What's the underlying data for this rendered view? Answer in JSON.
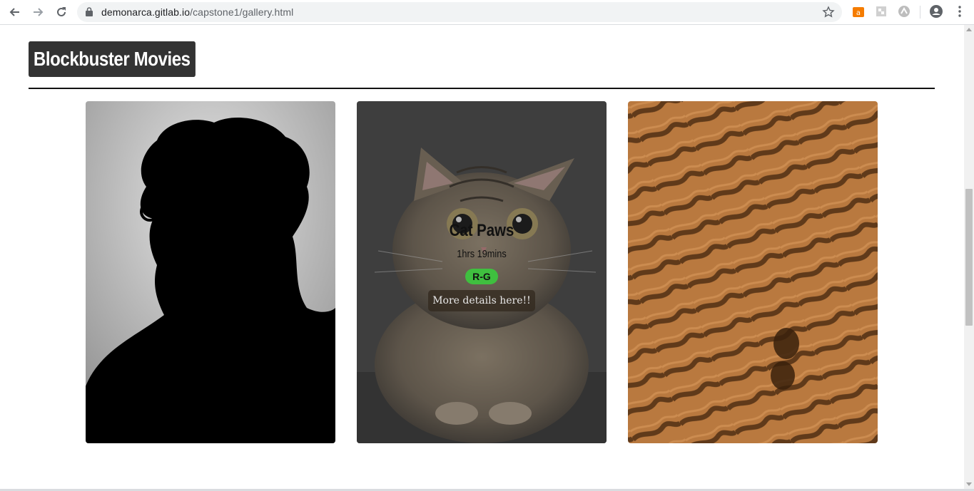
{
  "browser": {
    "url_host": "demonarca.gitlab.io",
    "url_path": "/capstone1/gallery.html",
    "icons": [
      "back-arrow-icon",
      "forward-arrow-icon",
      "reload-icon",
      "lock-icon",
      "star-icon",
      "extension-icon",
      "profile-icon",
      "menu-icon"
    ]
  },
  "page": {
    "heading": "Blockbuster Movies"
  },
  "cards": [
    {
      "image": "silhouette-portrait"
    },
    {
      "image": "cat-portrait",
      "title": "Cat Paws",
      "duration": "1hrs 19mins",
      "rating": "R-G",
      "details_label": "More details here!!"
    },
    {
      "image": "desert-sand-dunes-footprint"
    }
  ],
  "colors": {
    "heading_bg": "#333333",
    "rating_badge": "#3fbf3f",
    "sand": "#b9793f"
  }
}
